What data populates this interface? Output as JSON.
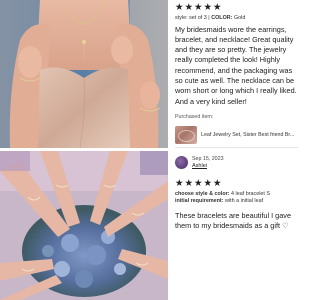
{
  "review1": {
    "stars": [
      "★",
      "★",
      "★",
      "★",
      "★"
    ],
    "meta_style_label": "style:",
    "meta_style_value": "set of 3",
    "meta_color_label": "COLOR:",
    "meta_color_value": "Gold",
    "text": "My bridesmaids wore the earrings, bracelet, and necklace! Great quality and they are so pretty. The jewelry really completed the look! Highly recommend, and the packaging was so cute as well. The necklace can be worn short or long which I really liked. And a very kind seller!",
    "purchased_label": "Purchased item:",
    "purchased_item": "Leaf Jewelry Set, Sister Best friend Br..."
  },
  "review2": {
    "date": "Sep 15, 2023",
    "name": "Ashlei",
    "stars": [
      "★",
      "★",
      "★",
      "★",
      "★"
    ],
    "meta_style_label": "choose style & color:",
    "meta_style_value": "4 leaf bracelet S",
    "meta_initial_label": "initial requirement:",
    "meta_initial_value": "with a initial leaf",
    "text": "These bracelets are beautiful I gave them to my bridesmaids as a gift ♡"
  },
  "colors": {
    "dress": "#d8b6a2",
    "skin": "#e6b49e",
    "background_top": "#5f7fa8",
    "flowers": "#6b86b8"
  }
}
